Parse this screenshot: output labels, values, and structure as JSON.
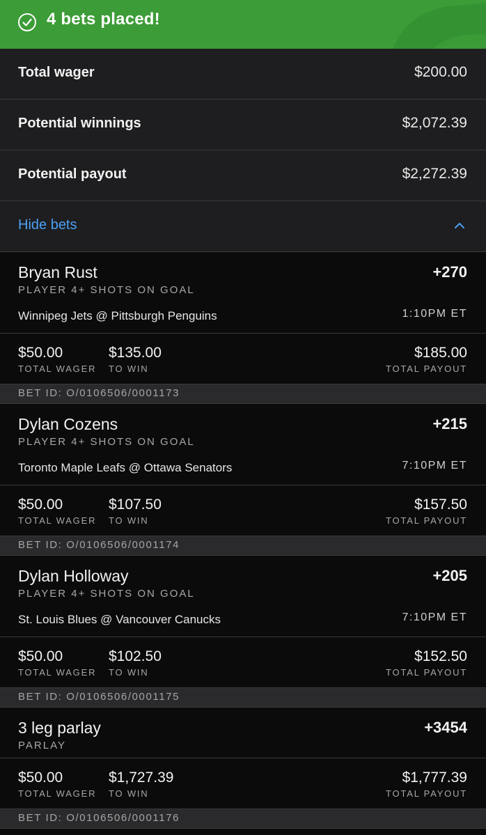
{
  "banner": {
    "title": "4 bets placed!",
    "icon": "check-circle-icon",
    "color": "#3c9c37"
  },
  "summary": {
    "total_wager": {
      "label": "Total wager",
      "value": "$200.00"
    },
    "potential_winnings": {
      "label": "Potential winnings",
      "value": "$2,072.39"
    },
    "potential_payout": {
      "label": "Potential payout",
      "value": "$2,272.39"
    },
    "toggle": {
      "label": "Hide bets",
      "icon": "chevron-up-icon"
    }
  },
  "labels": {
    "total_wager": "TOTAL WAGER",
    "to_win": "TO WIN",
    "total_payout": "TOTAL PAYOUT"
  },
  "bets": [
    {
      "name": "Bryan Rust",
      "odds": "+270",
      "market": "PLAYER 4+ SHOTS ON GOAL",
      "game": "Winnipeg Jets @ Pittsburgh Penguins",
      "time": "1:10PM ET",
      "wager": "$50.00",
      "to_win": "$135.00",
      "payout": "$185.00",
      "bet_id": "BET ID: O/0106506/0001173"
    },
    {
      "name": "Dylan Cozens",
      "odds": "+215",
      "market": "PLAYER 4+ SHOTS ON GOAL",
      "game": "Toronto Maple Leafs @ Ottawa Senators",
      "time": "7:10PM ET",
      "wager": "$50.00",
      "to_win": "$107.50",
      "payout": "$157.50",
      "bet_id": "BET ID: O/0106506/0001174"
    },
    {
      "name": "Dylan Holloway",
      "odds": "+205",
      "market": "PLAYER 4+ SHOTS ON GOAL",
      "game": "St. Louis Blues @ Vancouver Canucks",
      "time": "7:10PM ET",
      "wager": "$50.00",
      "to_win": "$102.50",
      "payout": "$152.50",
      "bet_id": "BET ID: O/0106506/0001175"
    },
    {
      "name": "3 leg parlay",
      "odds": "+3454",
      "market": "PARLAY",
      "wager": "$50.00",
      "to_win": "$1,727.39",
      "payout": "$1,777.39",
      "bet_id": "BET ID: O/0106506/0001176"
    }
  ]
}
